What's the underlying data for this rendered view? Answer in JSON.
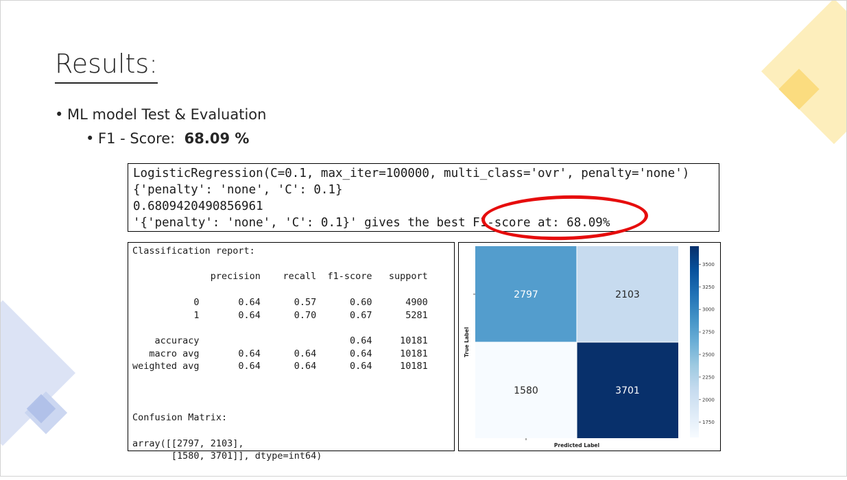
{
  "slide": {
    "title": "Results:",
    "bullets": [
      {
        "text": "ML model Test & Evaluation"
      },
      {
        "prefix": "F1 - Score:  ",
        "value": "68.09 %"
      }
    ]
  },
  "code_output": {
    "lines": [
      "LogisticRegression(C=0.1, max_iter=100000, multi_class='ovr', penalty='none')",
      "{'penalty': 'none', 'C': 0.1}",
      "0.6809420490856961",
      "'{'penalty': 'none', 'C': 0.1}' gives the best F1-score at: 68.09%"
    ]
  },
  "report": {
    "lines": [
      "Classification report:",
      "",
      "              precision    recall  f1-score   support",
      "",
      "           0       0.64      0.57      0.60      4900",
      "           1       0.64      0.70      0.67      5281",
      "",
      "    accuracy                           0.64     10181",
      "   macro avg       0.64      0.64      0.64     10181",
      "weighted avg       0.64      0.64      0.64     10181",
      "",
      "",
      "",
      "Confusion Matrix:",
      "",
      "array([[2797, 2103],",
      "       [1580, 3701]], dtype=int64)"
    ]
  },
  "chart_data": {
    "type": "heatmap",
    "title": "",
    "xlabel": "Predicted Label",
    "ylabel": "True Label",
    "matrix": [
      [
        2797,
        2103
      ],
      [
        1580,
        3701
      ]
    ],
    "colormap": "Blues",
    "colorbar_range": [
      1580,
      3701
    ],
    "colorbar_ticks": [
      3500,
      3250,
      3000,
      2750,
      2500,
      2250,
      2000,
      1750
    ]
  },
  "colors": {
    "highlight_circle": "#e60d0d",
    "deco_gold": "#fde8a6",
    "deco_blue": "#d7dff3"
  }
}
